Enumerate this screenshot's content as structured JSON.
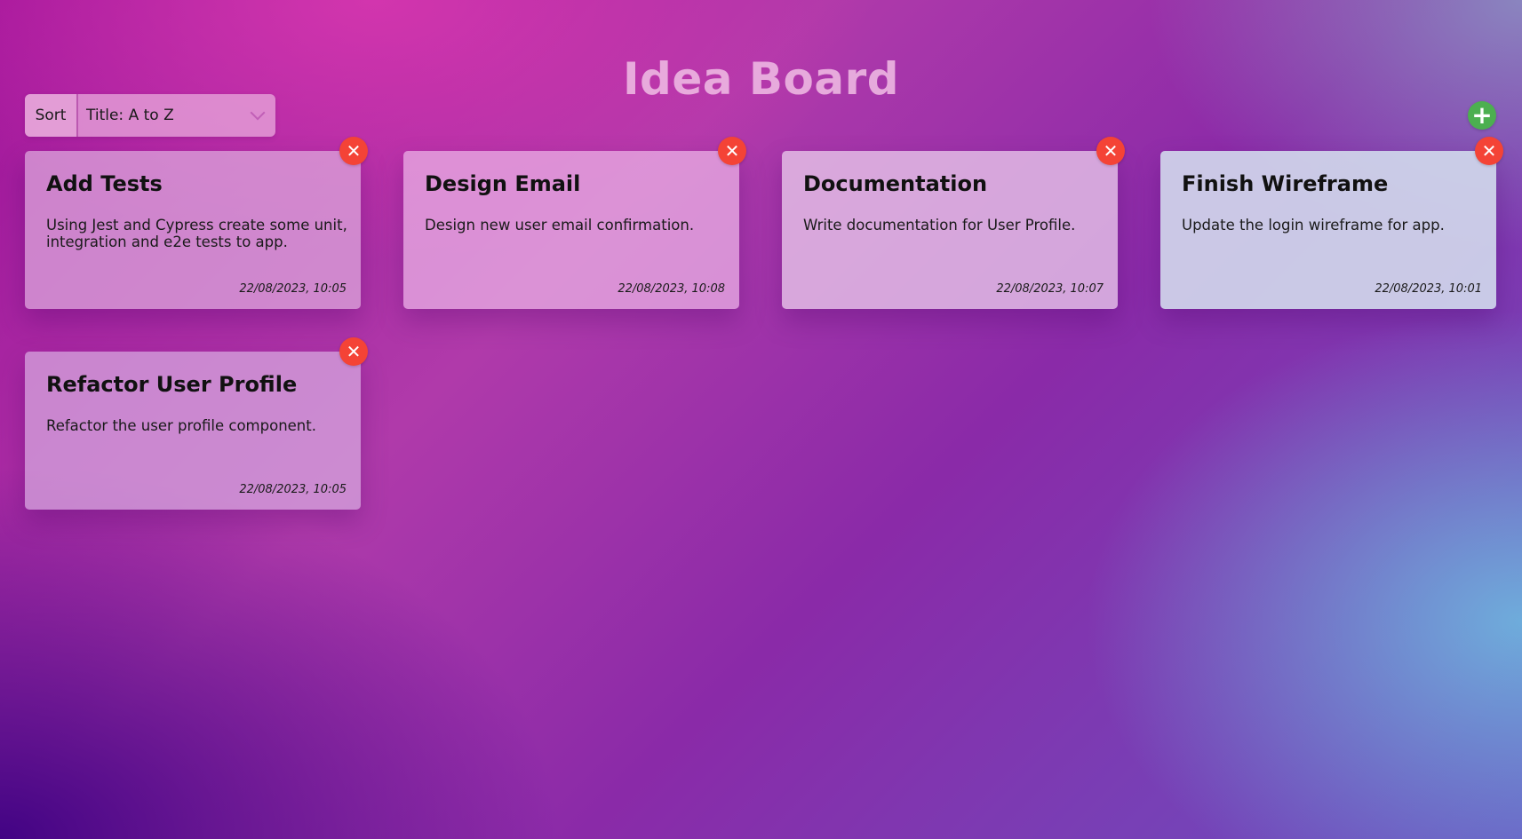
{
  "header": {
    "title": "Idea Board"
  },
  "toolbar": {
    "sort_label": "Sort",
    "sort_selected": "Title: A to Z",
    "add_icon": "plus-icon",
    "add_symbol": "+"
  },
  "cards": [
    {
      "title": "Add Tests",
      "description": "Using Jest and Cypress create some unit, integration and e2e tests to app.",
      "date": "22/08/2023, 10:05"
    },
    {
      "title": "Design Email",
      "description": "Design new user email confirmation.",
      "date": "22/08/2023, 10:08"
    },
    {
      "title": "Documentation",
      "description": "Write documentation for User Profile.",
      "date": "22/08/2023, 10:07"
    },
    {
      "title": "Finish Wireframe",
      "description": "Update the login wireframe for app.",
      "date": "22/08/2023, 10:01"
    },
    {
      "title": "Refactor User Profile",
      "description": "Refactor the user profile component.",
      "date": "22/08/2023, 10:05"
    }
  ],
  "icons": {
    "delete": "close-icon",
    "delete_symbol": "✕"
  },
  "colors": {
    "add_button": "#4caf50",
    "delete_button": "#f44336"
  }
}
